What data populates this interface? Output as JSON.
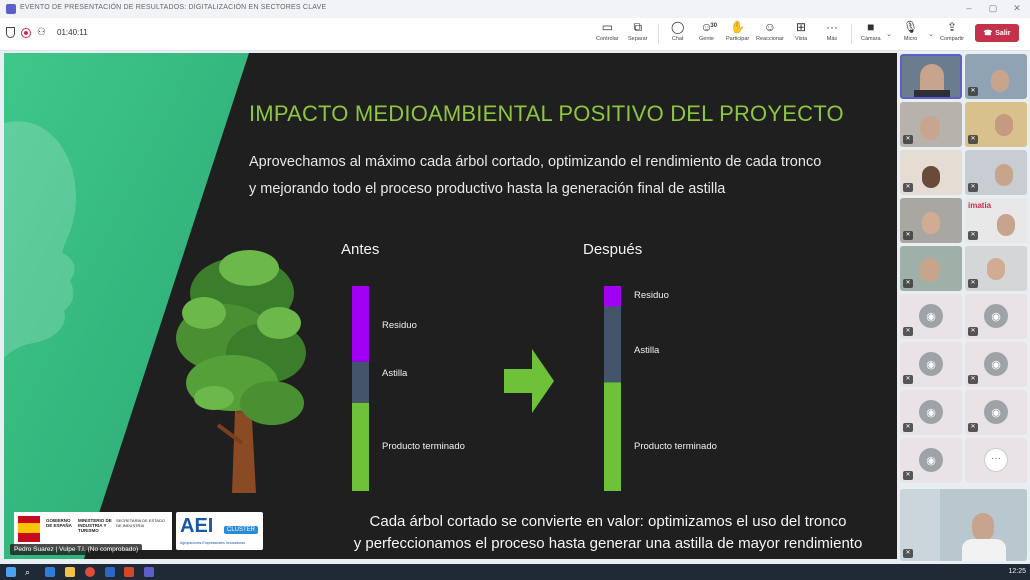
{
  "window": {
    "title": "EVENTO DE PRESENTACIÓN DE RESULTADOS: DIGITALIZACIÓN EN SECTORES CLAVE"
  },
  "meeting": {
    "timer": "01:40:11",
    "toolbar": {
      "share": "Controlar",
      "popout": "Separar",
      "chat": "Chat",
      "people": "Gente",
      "people_count": "30",
      "raise": "Participar",
      "react": "Reaccionar",
      "view": "Vista",
      "more": "Más",
      "camera": "Cámara",
      "mic": "Micro",
      "share_screen": "Compartir",
      "leave": "Salir"
    }
  },
  "slide": {
    "title": "IMPACTO MEDIOAMBIENTAL POSITIVO DEL PROYECTO",
    "subtitle_line1": "Aprovechamos al máximo cada árbol cortado, optimizando el rendimiento de cada tronco",
    "subtitle_line2": "y mejorando todo el proceso productivo hasta la generación final de astilla",
    "before": {
      "heading": "Antes",
      "segments": [
        {
          "label": "Residuo",
          "fraction": 0.37,
          "color": "#a100f2"
        },
        {
          "label": "Astilla",
          "fraction": 0.2,
          "color": "#44546a"
        },
        {
          "label": "Producto terminado",
          "fraction": 0.43,
          "color": "#70c13a"
        }
      ]
    },
    "after": {
      "heading": "Después",
      "segments": [
        {
          "label": "Residuo",
          "fraction": 0.1,
          "color": "#a100f2"
        },
        {
          "label": "Astilla",
          "fraction": 0.37,
          "color": "#44546a"
        },
        {
          "label": "Producto terminado",
          "fraction": 0.53,
          "color": "#70c13a"
        }
      ]
    },
    "bottom_line1": "Cada árbol cortado se convierte en valor: optimizamos el uso del tronco",
    "bottom_line2": "y perfeccionamos el proceso hasta generar una astilla de mayor rendimiento",
    "logo_gov_1": "GOBIERNO DE ESPAÑA",
    "logo_gov_2": "MINISTERIO DE INDUSTRIA Y TURISMO",
    "logo_gov_3": "SECRETARÍA DE ESTADO DE INDUSTRIA",
    "logo_aei": "AEI",
    "logo_aei_cluster": "CLUSTER",
    "logo_aei_sub": "Agrupaciones Empresariales Innovadoras",
    "speaker_label": "Pedro Suarez | Vulpe T.I. (No comprobado)"
  },
  "gallery": {
    "imatia_label": "imatia"
  },
  "taskbar": {
    "clock": "12:25"
  },
  "colors": {
    "accent_green": "#8dc63f",
    "leave_red": "#c4314b",
    "teams_purple": "#5b5fc7"
  }
}
